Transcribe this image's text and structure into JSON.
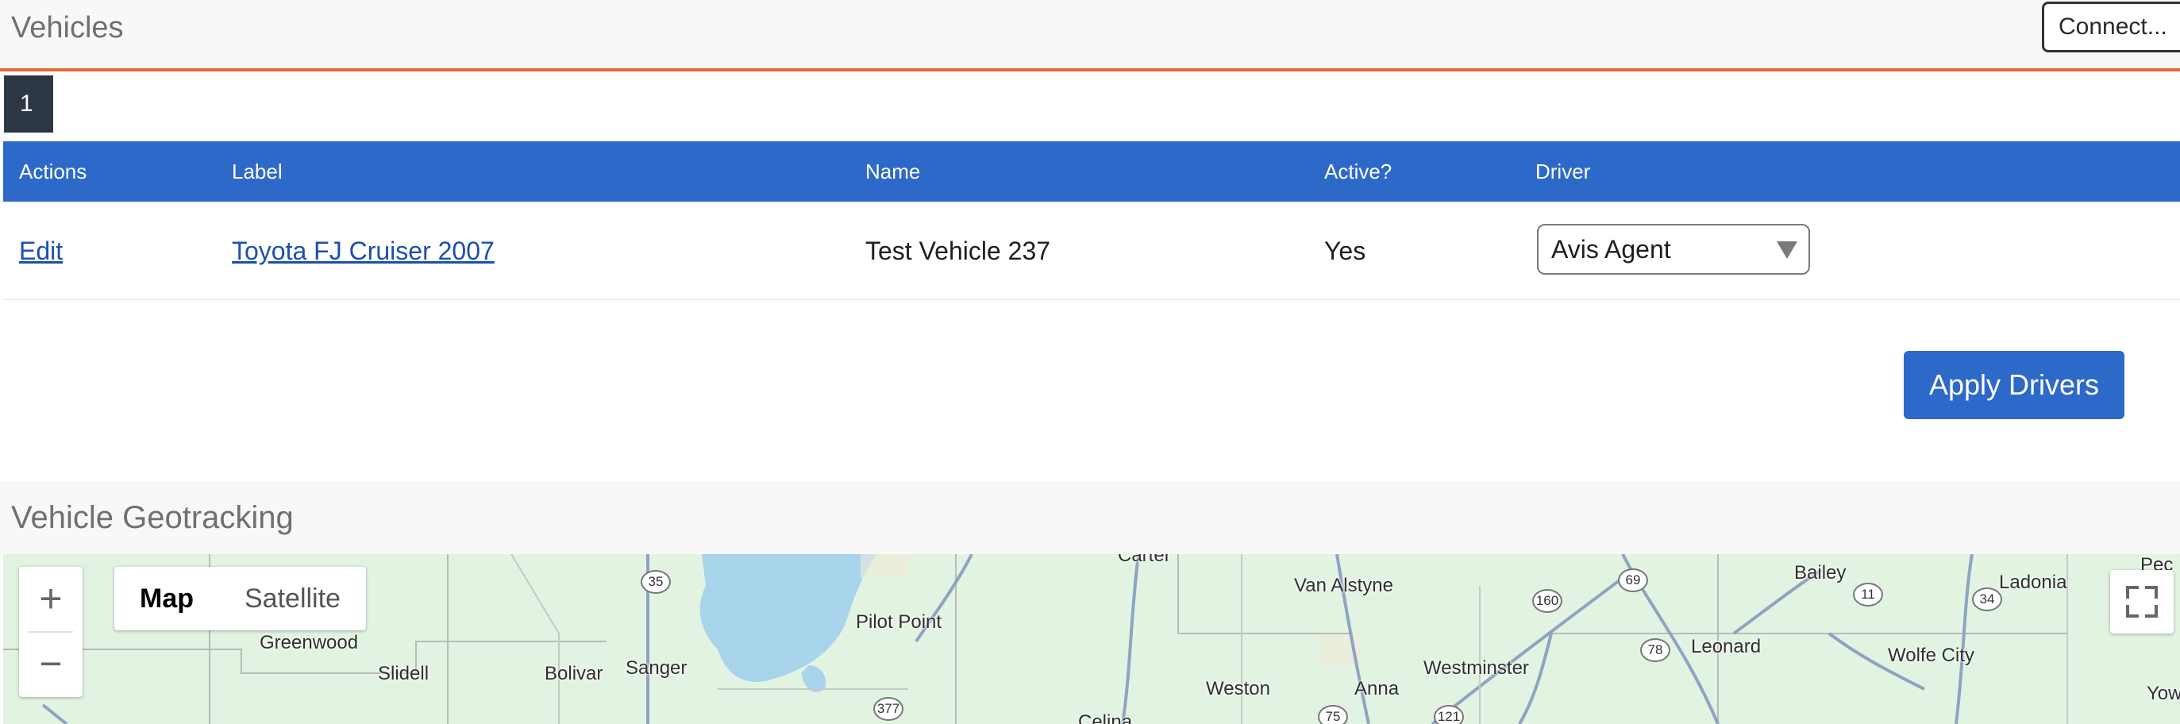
{
  "header": {
    "title": "Vehicles",
    "connect_label": "Connect..."
  },
  "pagination": {
    "current_page": "1"
  },
  "table": {
    "columns": [
      "Actions",
      "Label",
      "Name",
      "Active?",
      "Driver"
    ],
    "rows": [
      {
        "action": "Edit",
        "label": "Toyota FJ Cruiser 2007",
        "name": "Test Vehicle 237",
        "active": "Yes",
        "driver": "Avis Agent"
      }
    ]
  },
  "apply_label": "Apply Drivers",
  "geotracking": {
    "title": "Vehicle Geotracking"
  },
  "map": {
    "zoom_in": "+",
    "zoom_out": "−",
    "types": [
      "Map",
      "Satellite"
    ],
    "labels": [
      "Greenwood",
      "Slidell",
      "Bolivar",
      "Sanger",
      "Pilot Point",
      "Van Alstyne",
      "Weston",
      "Anna",
      "Westminster",
      "Leonard",
      "Bailey",
      "Ladonia",
      "Wolfe City",
      "Celina",
      "Pec",
      "Yow",
      "Carter"
    ],
    "shields": [
      "35",
      "377",
      "75",
      "121",
      "160",
      "69",
      "78",
      "11",
      "34"
    ]
  },
  "colors": {
    "accent": "#2d69c8",
    "header_rule": "#e06a3c",
    "badge": "#2c3746",
    "map_land": "#e2f4e1",
    "map_water": "#a8d4ec"
  }
}
